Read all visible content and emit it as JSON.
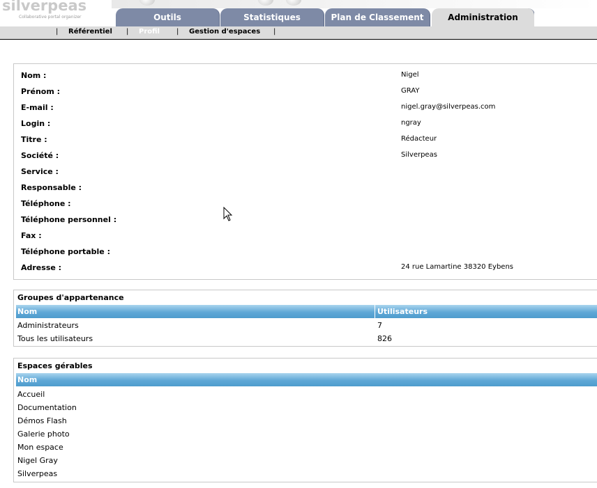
{
  "logo": {
    "text": "silverpeas",
    "tagline": "Collaborative portal organizer"
  },
  "tabs": [
    {
      "label": "Outils",
      "active": false
    },
    {
      "label": "Statistiques",
      "active": false
    },
    {
      "label": "Plan de Classement",
      "active": false
    },
    {
      "label": "Administration",
      "active": true
    }
  ],
  "subnav": [
    {
      "label": "Référentiel",
      "current": false
    },
    {
      "label": "Profil",
      "current": true
    },
    {
      "label": "Gestion d'espaces",
      "current": false
    }
  ],
  "profile": [
    {
      "label": "Nom :",
      "value": "Nigel"
    },
    {
      "label": "Prénom :",
      "value": "GRAY"
    },
    {
      "label": "E-mail :",
      "value": "nigel.gray@silverpeas.com"
    },
    {
      "label": "Login :",
      "value": "ngray"
    },
    {
      "label": "Titre :",
      "value": "Rédacteur"
    },
    {
      "label": "Société :",
      "value": "Silverpeas"
    },
    {
      "label": "Service :",
      "value": ""
    },
    {
      "label": "Responsable :",
      "value": ""
    },
    {
      "label": "Téléphone :",
      "value": ""
    },
    {
      "label": "Téléphone personnel :",
      "value": ""
    },
    {
      "label": "Fax :",
      "value": ""
    },
    {
      "label": "Téléphone portable :",
      "value": ""
    },
    {
      "label": "Adresse :",
      "value": "24 rue Lamartine 38320 Eybens"
    }
  ],
  "groups": {
    "title": "Groupes d'appartenance",
    "columns": [
      "Nom",
      "Utilisateurs"
    ],
    "rows": [
      {
        "name": "Administrateurs",
        "users": "7"
      },
      {
        "name": "Tous les utilisateurs",
        "users": "826"
      }
    ]
  },
  "spaces": {
    "title": "Espaces gérables",
    "columns": [
      "Nom"
    ],
    "rows": [
      "Accueil",
      "Documentation",
      "Démos Flash",
      "Galerie photo",
      "Mon espace",
      "Nigel Gray",
      "Silverpeas"
    ]
  }
}
